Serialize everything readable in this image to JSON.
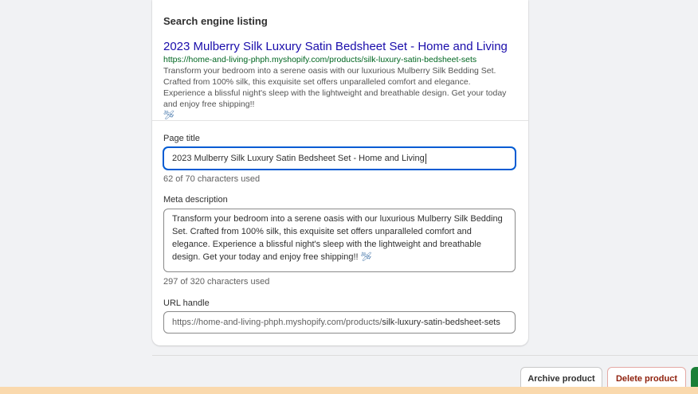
{
  "seo": {
    "heading": "Search engine listing",
    "preview": {
      "title": "2023 Mulberry Silk Luxury Satin Bedsheet Set - Home and Living",
      "url": "https://home-and-living-phph.myshopify.com/products/silk-luxury-satin-bedsheet-sets",
      "description": "Transform your bedroom into a serene oasis with our luxurious Mulberry Silk Bedding Set. Crafted from 100% silk, this exquisite set offers unparalleled comfort and elegance. Experience a blissful night's sleep with the lightweight and breathable design. Get your today and enjoy free shipping!!"
    },
    "page_title": {
      "label": "Page title",
      "value": "2023 Mulberry Silk Luxury Satin Bedsheet Set - Home and Living",
      "help": "62 of 70 characters used"
    },
    "meta_description": {
      "label": "Meta description",
      "value": "Transform your bedroom into a serene oasis with our luxurious Mulberry Silk Bedding Set. Crafted from 100% silk, this exquisite set offers unparalleled comfort and elegance. Experience a blissful night's sleep with the lightweight and breathable design. Get your today and enjoy free shipping!!",
      "help": "297 of 320 characters used"
    },
    "url_handle": {
      "label": "URL handle",
      "prefix": "https://home-and-living-phph.myshopify.com/products/",
      "value": "silk-luxury-satin-bedsheet-sets"
    }
  },
  "actions": {
    "archive": "Archive product",
    "delete": "Delete product"
  },
  "icons": {
    "emoji": "airplane-emoji-icon"
  }
}
